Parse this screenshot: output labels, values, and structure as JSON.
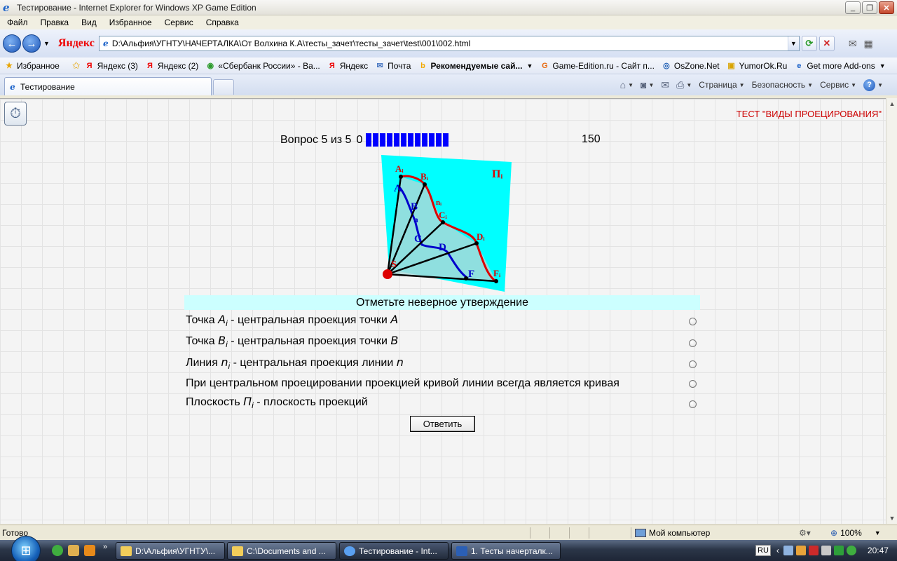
{
  "window": {
    "title": "Тестирование - Internet Explorer for Windows XP Game Edition"
  },
  "menu": [
    "Файл",
    "Правка",
    "Вид",
    "Избранное",
    "Сервис",
    "Справка"
  ],
  "address": {
    "search_brand": "Яндекс",
    "url": "D:\\Альфия\\УГНТУ\\НАЧЕРТАЛКА\\От Волхина К.А\\тесты_зачет\\тесты_зачет\\test\\001\\002.html"
  },
  "favorites": [
    {
      "label": "Избранное",
      "icon": "star-icon",
      "color": "#e8a400"
    },
    {
      "label": "Яндекс (3)",
      "icon": "yandex-icon",
      "color": "#e00000"
    },
    {
      "label": "Яндекс (2)",
      "icon": "yandex-icon",
      "color": "#e00000"
    },
    {
      "label": "«Сбербанк России» - Ва...",
      "icon": "sberbank-icon",
      "color": "#2b9a2b"
    },
    {
      "label": "Яндекс",
      "icon": "yandex-icon",
      "color": "#e00000"
    },
    {
      "label": "Почта",
      "icon": "mail-icon",
      "color": "#4a78c2"
    },
    {
      "label": "Рекомендуемые сай...",
      "icon": "bing-icon",
      "color": "#f2a900"
    },
    {
      "label": "Game-Edition.ru - Сайт п...",
      "icon": "game-edition-icon",
      "color": "#e86a10"
    },
    {
      "label": "OsZone.Net",
      "icon": "oszone-icon",
      "color": "#1f5fb5"
    },
    {
      "label": "YumorOk.Ru",
      "icon": "yumorok-icon",
      "color": "#d9a400"
    },
    {
      "label": "Get more Add-ons",
      "icon": "ie-page-icon",
      "color": "#1d63c9"
    }
  ],
  "tab": {
    "label": "Тестирование"
  },
  "command_bar": {
    "page": "Страница",
    "safety": "Безопасность",
    "tools": "Сервис"
  },
  "page": {
    "test_title": "ТЕСТ \"ВИДЫ ПРОЕЦИРОВАНИЯ\"",
    "question_progress": "Вопрос 5 из 5",
    "bar_min": "0",
    "bar_max": "150",
    "bar_segments": 12,
    "instruction": "Отметьте неверное утверждение",
    "options": [
      {
        "before": "Точка ",
        "sym": "A",
        "sub": "i",
        "after": " - центральная проекция точки ",
        "sym2": "A"
      },
      {
        "before": "Точка ",
        "sym": "B",
        "sub": "i",
        "after": " - центральная проекция точки ",
        "sym2": "B"
      },
      {
        "before": "Линия ",
        "sym": "n",
        "sub": "i",
        "after": " - центральная проекция линии ",
        "sym2": "n"
      },
      {
        "before": "При центральном проецировании проекцией кривой линии всегда является кривая",
        "sym": "",
        "sub": "",
        "after": "",
        "sym2": ""
      },
      {
        "before": "Плоскость ",
        "sym": "П",
        "sub": "i",
        "after": " - плоскость проекций",
        "sym2": ""
      }
    ],
    "answer_button": "Ответить",
    "figure": {
      "plane_label": "Пᵢ",
      "projected_labels": [
        "Aᵢ",
        "Bᵢ",
        "nᵢ",
        "Cᵢ",
        "Dᵢ",
        "Fᵢ"
      ],
      "space_labels": [
        "A",
        "B",
        "n",
        "C",
        "D",
        "F",
        "S"
      ],
      "plane_color": "#00ffff",
      "projection_color": "#dd0000",
      "curve_color": "#0000cc"
    }
  },
  "status": {
    "text": "Готово",
    "zone": "Мой компьютер",
    "zoom": "100%"
  },
  "taskbar": {
    "tasks": [
      {
        "label": "D:\\Альфия\\УГНТУ\\...",
        "icon": "folder-icon"
      },
      {
        "label": "C:\\Documents and ...",
        "icon": "folder-icon"
      },
      {
        "label": "Тестирование - Int...",
        "icon": "ie-icon"
      },
      {
        "label": "1. Тесты начерталк...",
        "icon": "word-icon"
      }
    ],
    "lang": "RU",
    "clock": "20:47"
  }
}
